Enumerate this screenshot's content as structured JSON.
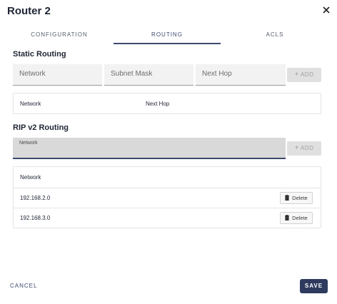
{
  "dialog": {
    "title": "Router 2",
    "close_icon": "close-icon"
  },
  "tabs": [
    {
      "label": "CONFIGURATION",
      "active": false
    },
    {
      "label": "ROUTING",
      "active": true
    },
    {
      "label": "ACLS",
      "active": false
    }
  ],
  "static_routing": {
    "title": "Static Routing",
    "network_placeholder": "Network",
    "subnet_placeholder": "Subnet Mask",
    "nexthop_placeholder": "Next Hop",
    "add_label": "ADD",
    "add_icon": "plus-icon",
    "table": {
      "col_network": "Network",
      "col_nexthop": "Next Hop"
    }
  },
  "rip": {
    "title": "RIP v2 Routing",
    "network_label": "Network",
    "add_label": "ADD",
    "add_icon": "plus-icon",
    "table": {
      "col_network": "Network",
      "rows": [
        {
          "network": "192.168.2.0",
          "delete_label": "Delete"
        },
        {
          "network": "192.168.3.0",
          "delete_label": "Delete"
        }
      ]
    }
  },
  "footer": {
    "cancel_label": "CANCEL",
    "save_label": "SAVE"
  },
  "colors": {
    "accent": "#3d4a6e",
    "primary_button": "#2e3b5e"
  }
}
